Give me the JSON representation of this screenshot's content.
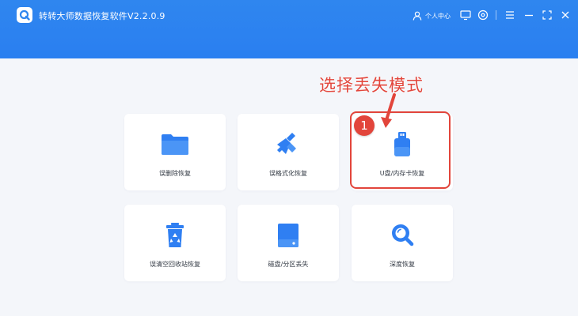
{
  "window": {
    "title": "转转大师数据恢复软件V2.2.0.9",
    "user_label": "个人中心",
    "controls": [
      "monitor-icon",
      "settings-icon",
      "menu-icon",
      "fullscreen-icon",
      "close-icon"
    ]
  },
  "annotation": {
    "callout": "选择丢失模式",
    "badge": "1"
  },
  "modes": [
    {
      "label": "误删除恢复",
      "icon": "folder-icon"
    },
    {
      "label": "误格式化恢复",
      "icon": "broom-icon"
    },
    {
      "label": "U盘/内存卡恢复",
      "icon": "usb-drive-icon"
    },
    {
      "label": "误清空回收站恢复",
      "icon": "recycle-bin-icon"
    },
    {
      "label": "磁盘/分区丢失",
      "icon": "hard-disk-icon"
    },
    {
      "label": "深度恢复",
      "icon": "magnifier-icon"
    }
  ],
  "colors": {
    "header": "#2f86ef",
    "icon_blue": "#2f7ff2",
    "annotation_red": "#e2453b",
    "background": "#f4f6fa"
  }
}
